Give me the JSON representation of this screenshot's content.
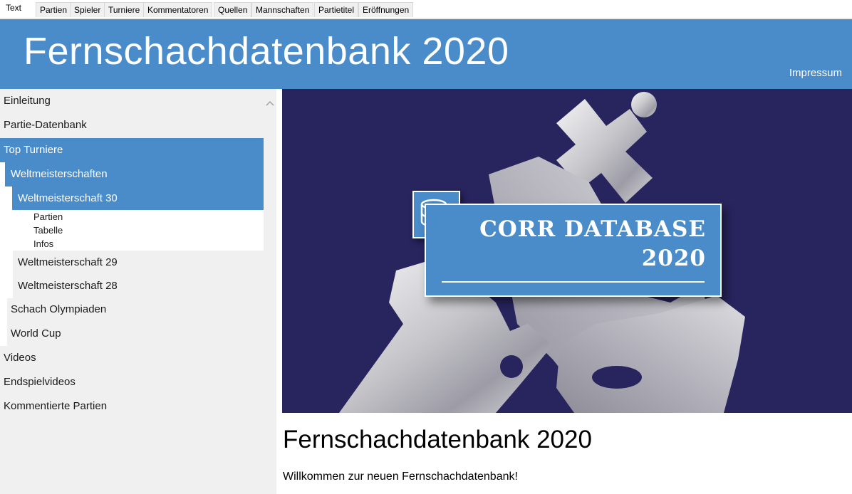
{
  "tabs": [
    "Text",
    "Partien",
    "Spieler",
    "Turniere",
    "Kommentatoren",
    "Quellen",
    "Mannschaften",
    "Partietitel",
    "Eröffnungen"
  ],
  "header": {
    "title": "Fernschachdatenbank 2020",
    "impressum": "Impressum"
  },
  "sidebar": {
    "items": [
      "Einleitung",
      "Partie-Datenbank",
      "Top Turniere",
      "Weltmeisterschaften",
      "Weltmeisterschaft 30",
      "Partien",
      "Tabelle",
      "Infos",
      "Weltmeisterschaft 29",
      "Weltmeisterschaft 28",
      "Schach Olympiaden",
      "World Cup",
      "Videos",
      "Endspielvideos",
      "Kommentierte Partien"
    ]
  },
  "banner": {
    "line1": "CORR DATABASE",
    "line2": "2020"
  },
  "content": {
    "title": "Fernschachdatenbank 2020",
    "text": "Willkommen zur neuen Fernschachdatenbank!"
  },
  "colors": {
    "accent": "#4a8bc9",
    "banner_bg": "#28245e"
  }
}
